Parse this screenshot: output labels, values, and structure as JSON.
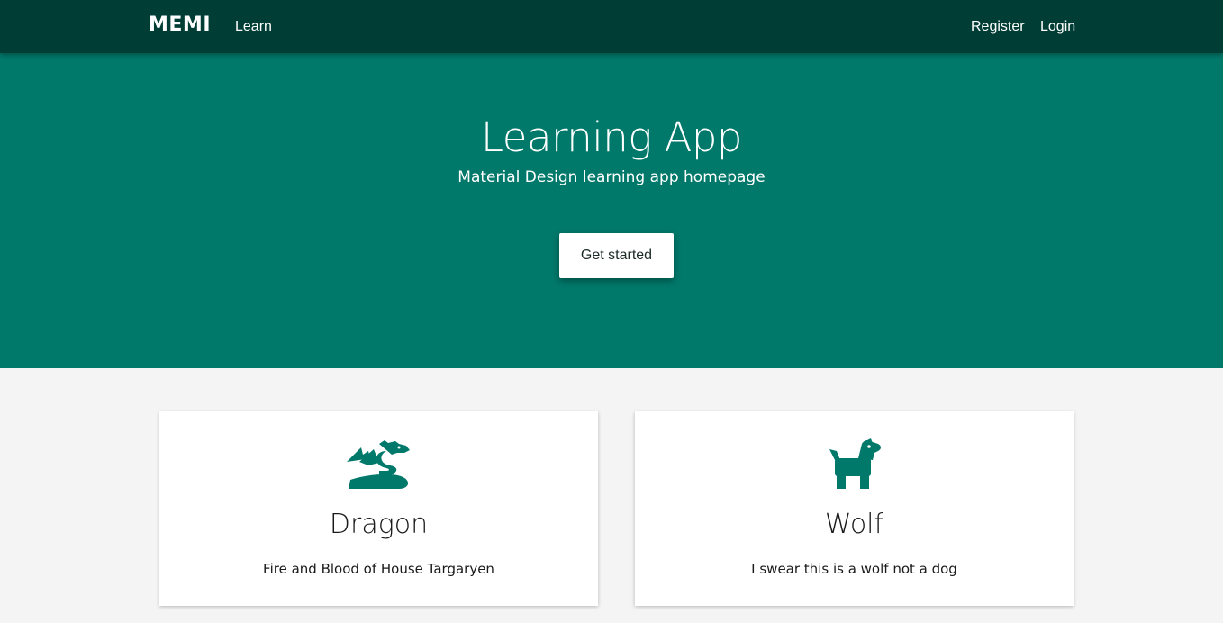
{
  "navbar": {
    "brand": "MEMI",
    "links": {
      "learn": "Learn",
      "register": "Register",
      "login": "Login"
    },
    "background_color": "#003d35"
  },
  "hero": {
    "title": "Learning App",
    "subtitle": "Material Design learning app homepage",
    "cta_label": "Get started",
    "background_color": "#00786a"
  },
  "cards": [
    {
      "icon": "dragon-icon",
      "title": "Dragon",
      "description": "Fire and Blood of House Targaryen"
    },
    {
      "icon": "dog-icon",
      "title": "Wolf",
      "description": "I swear this is a wolf not a dog"
    }
  ],
  "colors": {
    "accent": "#00786a",
    "page_background": "#f4f4f4"
  }
}
